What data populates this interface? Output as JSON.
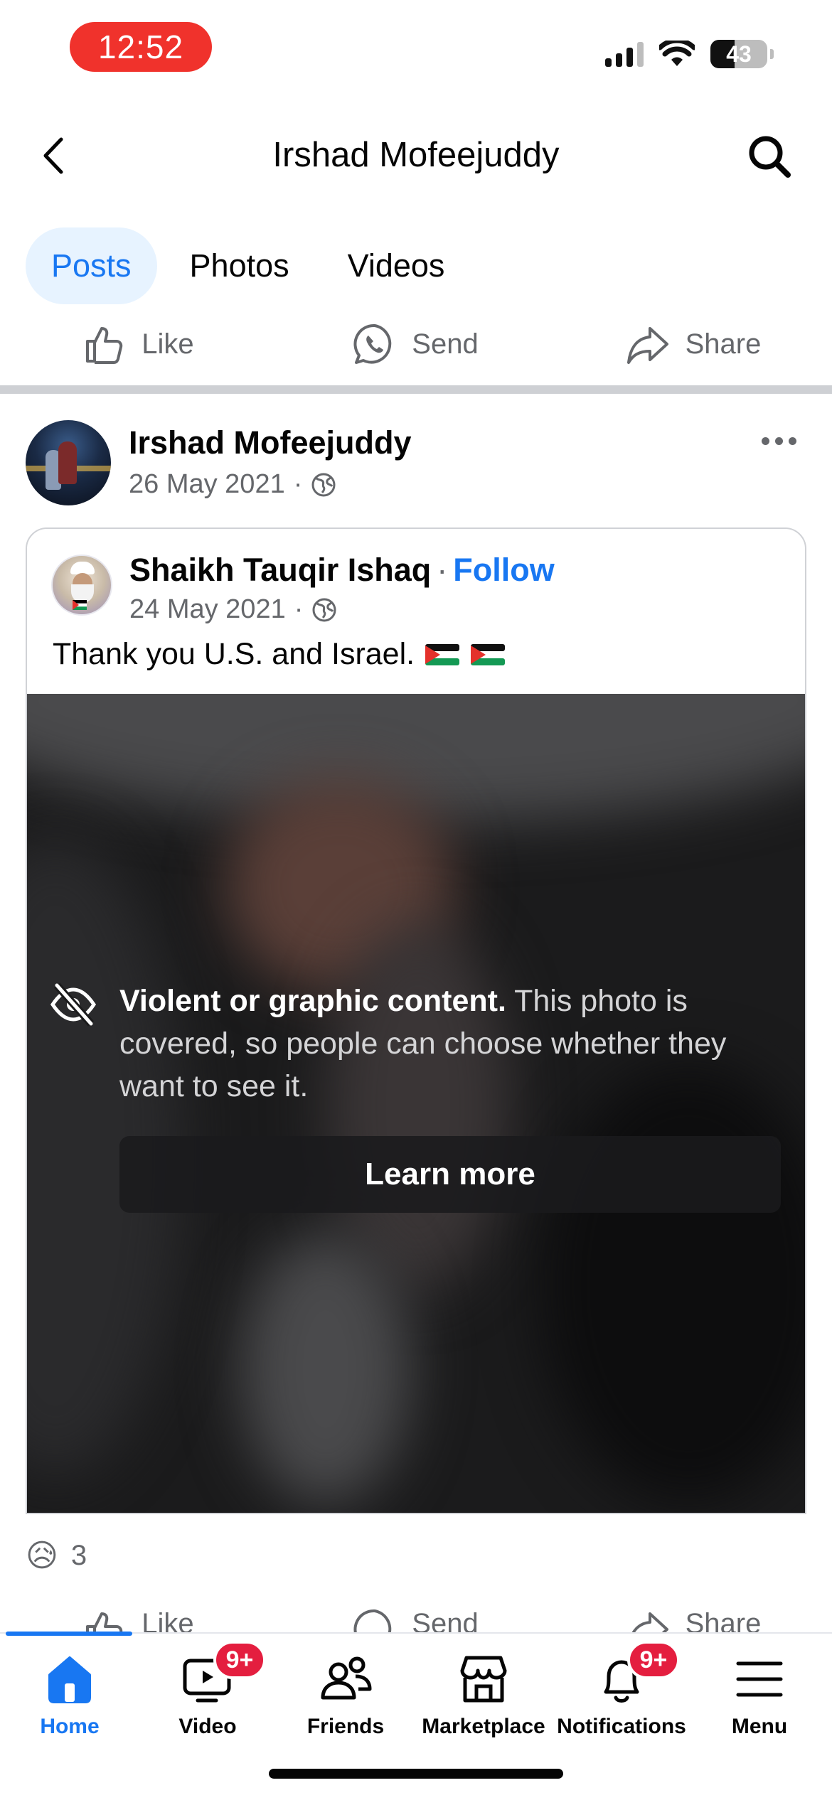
{
  "status_bar": {
    "time": "12:52",
    "battery": "43",
    "battery_level": 0.43
  },
  "header": {
    "title": "Irshad Mofeejuddy"
  },
  "tabs": [
    {
      "label": "Posts",
      "active": true
    },
    {
      "label": "Photos",
      "active": false
    },
    {
      "label": "Videos",
      "active": false
    }
  ],
  "actions": {
    "like": "Like",
    "send": "Send",
    "share": "Share"
  },
  "post": {
    "author": "Irshad Mofeejuddy",
    "date": "26 May 2021",
    "separator": "·",
    "shared": {
      "author": "Shaikh Tauqir Ishaq",
      "follow": "Follow",
      "date": "24 May 2021",
      "text": "Thank you U.S. and Israel.",
      "emoji": [
        "palestine-flag",
        "palestine-flag"
      ],
      "warning": {
        "title": "Violent or graphic content.",
        "body": "This photo is covered, so people can choose whether they want to see it.",
        "button": "Learn more"
      }
    },
    "reactions": {
      "emoji": "😥",
      "count": "3"
    }
  },
  "bottom_nav": [
    {
      "label": "Home",
      "icon": "home-icon",
      "active": true
    },
    {
      "label": "Video",
      "icon": "video-icon",
      "badge": "9+"
    },
    {
      "label": "Friends",
      "icon": "friends-icon"
    },
    {
      "label": "Marketplace",
      "icon": "marketplace-icon"
    },
    {
      "label": "Notifications",
      "icon": "bell-icon",
      "badge": "9+"
    },
    {
      "label": "Menu",
      "icon": "menu-icon"
    }
  ],
  "colors": {
    "accent": "#1877f2",
    "badge": "#e41e3f",
    "time_pill": "#f0322c",
    "secondary_text": "#65676b"
  }
}
